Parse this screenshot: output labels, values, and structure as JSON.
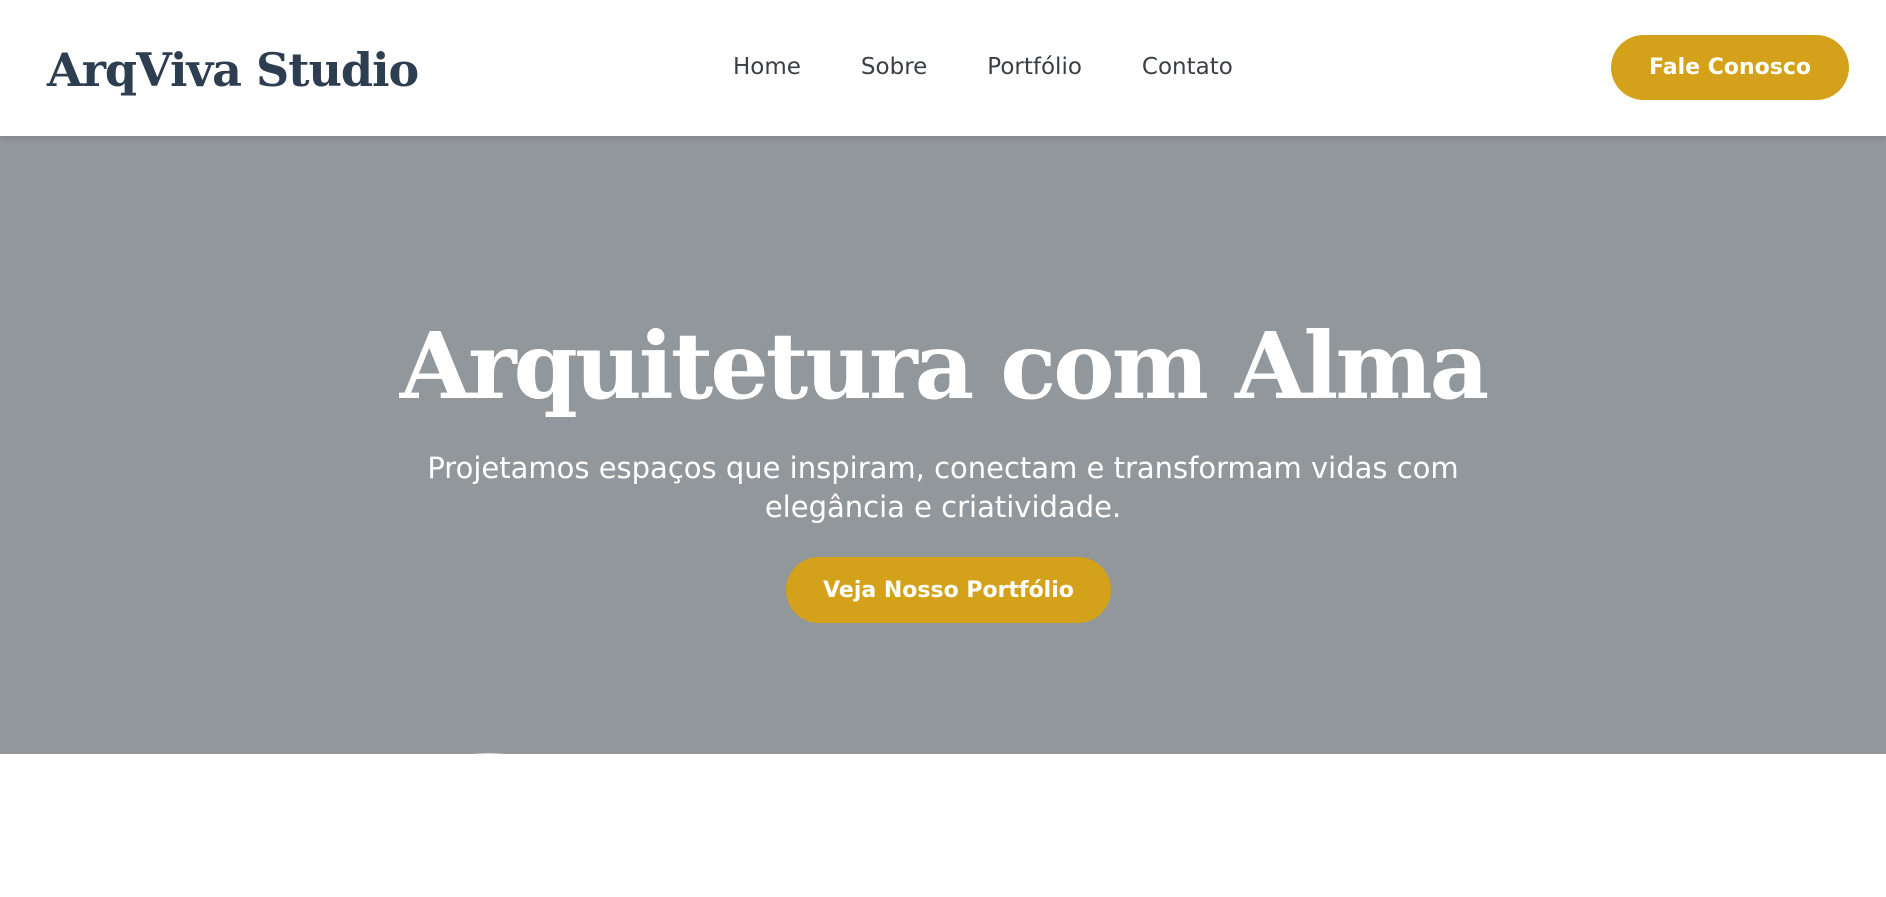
{
  "header": {
    "logo": "ArqViva Studio",
    "nav": [
      {
        "label": "Home"
      },
      {
        "label": "Sobre"
      },
      {
        "label": "Portfólio"
      },
      {
        "label": "Contato"
      }
    ],
    "cta_label": "Fale Conosco"
  },
  "hero": {
    "title": "Arquitetura com Alma",
    "subtitle": "Projetamos espaços que inspiram, conectam e transformam vidas com elegância e criatividade.",
    "cta_label": "Veja Nosso Portfólio"
  },
  "colors": {
    "brand_dark": "#2c3e50",
    "accent": "#d4a21a",
    "hero_overlay": "#92979b",
    "nav_text": "#3a3f45"
  }
}
